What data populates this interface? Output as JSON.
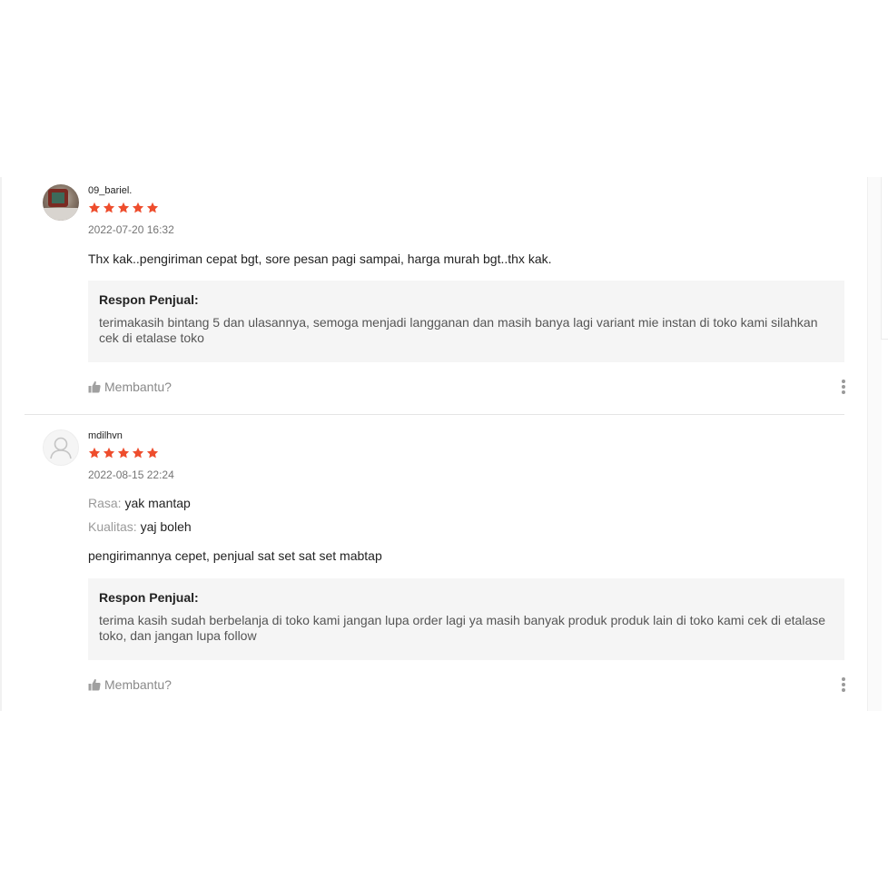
{
  "reviews": [
    {
      "username": "09_bariel.",
      "rating": 5,
      "date": "2022-07-20 16:32",
      "comment": "Thx kak..pengiriman cepat bgt, sore pesan pagi sampai, harga murah bgt..thx kak.",
      "response_title": "Respon Penjual:",
      "response_text": "terimakasih bintang 5 dan ulasannya, semoga menjadi langganan dan masih banya lagi variant mie instan di toko kami silahkan cek di etalase toko",
      "helpful_label": "Membantu?"
    },
    {
      "username": "mdilhvn",
      "rating": 5,
      "date": "2022-08-15 22:24",
      "attributes": [
        {
          "label": "Rasa:",
          "value": "yak mantap"
        },
        {
          "label": "Kualitas:",
          "value": "yaj boleh"
        }
      ],
      "comment": "pengirimannya cepet, penjual sat set sat set mabtap",
      "response_title": "Respon Penjual:",
      "response_text": "terima kasih sudah berbelanja di toko kami jangan lupa order lagi ya masih banyak produk produk lain di toko kami cek di etalase toko, dan jangan lupa follow",
      "helpful_label": "Membantu?"
    }
  ],
  "colors": {
    "star": "#ee4d2d",
    "response_bg": "#f5f5f5",
    "muted_text": "#8a8a8a"
  },
  "icons": {
    "star": "star-icon",
    "helpful": "thumbs-up-icon",
    "more": "more-vertical-icon",
    "default_avatar": "user-icon"
  }
}
